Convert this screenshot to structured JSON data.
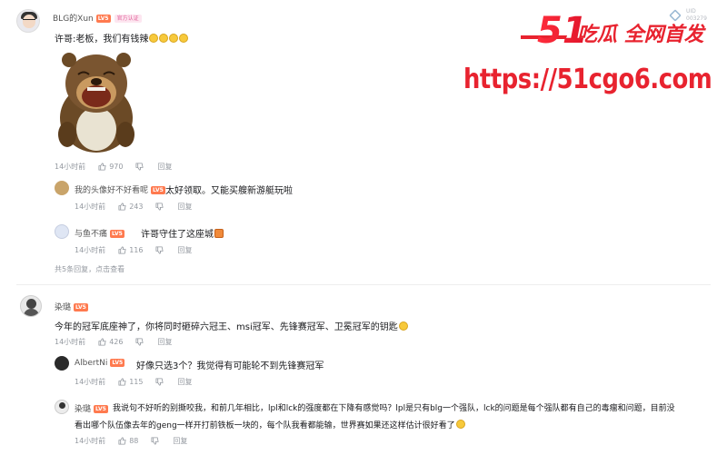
{
  "watermark": {
    "brand_num": "51",
    "brand_text": "吃瓜 全网首发",
    "url": "https://51cgo6.com"
  },
  "corner": {
    "line1": "UID",
    "line2": "003279"
  },
  "comments": [
    {
      "user": "BLG的Xun",
      "level": "LV5",
      "tag": "官方认证",
      "text": "许哥:老板，我们有钱辣",
      "time": "14小时前",
      "likes": "970",
      "reply_label": "回复",
      "replies": [
        {
          "user": "我的头像好不好看呢",
          "level": "LV5",
          "text": "太好领取。又能买艘新游艇玩啦",
          "time": "14小时前",
          "likes": "243",
          "reply_label": "回复"
        },
        {
          "user": "与鱼不痛",
          "level": "LV5",
          "text": "许哥守住了这座城",
          "time": "14小时前",
          "likes": "116",
          "reply_label": "回复"
        }
      ],
      "more_text": "共5条回复，",
      "more_link": "点击查看"
    },
    {
      "user": "染璐",
      "level": "LV5",
      "text": "今年的冠军底座神了，你将同时砸碎六冠王、msi冠军、先锋赛冠军、卫冕冠军的钥匙",
      "time": "14小时前",
      "likes": "426",
      "reply_label": "回复",
      "replies": [
        {
          "user": "AlbertNi",
          "level": "LV5",
          "text": "好像只选3个？我觉得有可能轮不到先锋赛冠军",
          "time": "14小时前",
          "likes": "115",
          "reply_label": "回复"
        },
        {
          "user": "染璐",
          "level": "LV5",
          "text": "我说句不好听的别撕咬我，和前几年相比，lpl和lck的强度都在下降有感觉吗？lpl是只有blg一个强队，lck的问题是每个强队都有自己的毒瘤和问题，目前没",
          "text2": "看出哪个队伍像去年的geng一样开打前铁板一块的，每个队我看都能输，世界赛如果还这样估计很好看了",
          "time": "14小时前",
          "likes": "88",
          "reply_label": "回复"
        }
      ]
    }
  ]
}
